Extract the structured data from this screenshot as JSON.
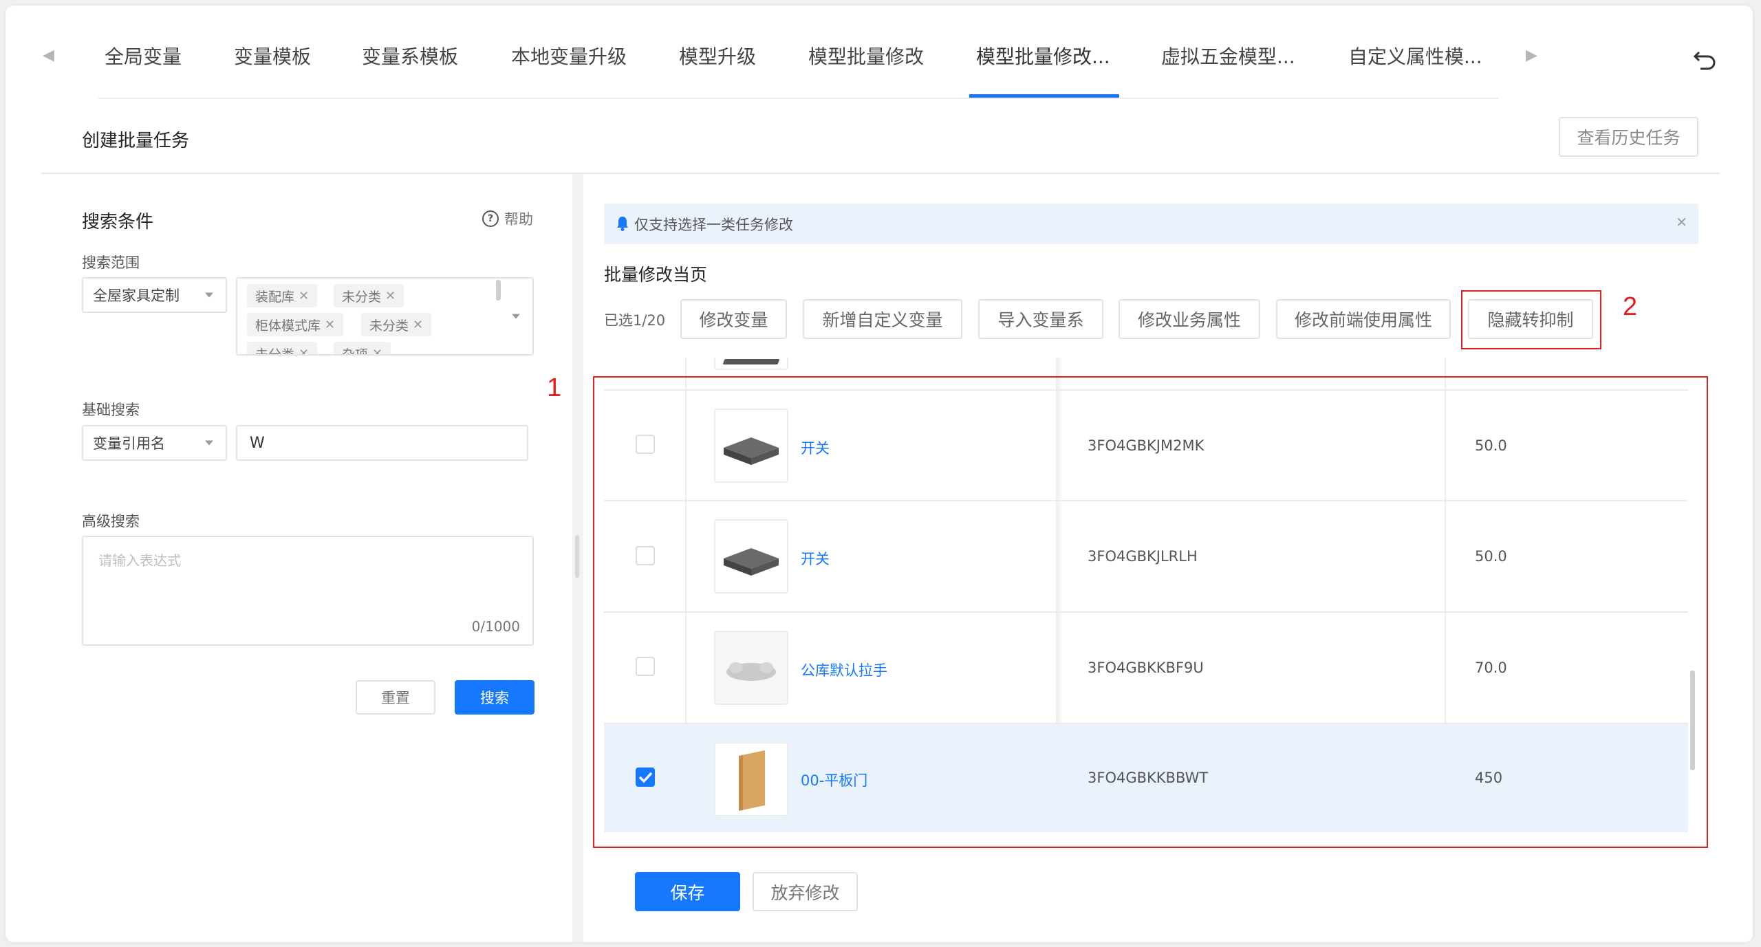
{
  "tabs": [
    {
      "label": "全局变量",
      "active": false
    },
    {
      "label": "变量模板",
      "active": false
    },
    {
      "label": "变量系模板",
      "active": false
    },
    {
      "label": "本地变量升级",
      "active": false
    },
    {
      "label": "模型升级",
      "active": false
    },
    {
      "label": "模型批量修改",
      "active": false
    },
    {
      "label": "模型批量修改...",
      "active": true
    },
    {
      "label": "虚拟五金模型...",
      "active": false
    },
    {
      "label": "自定义属性模...",
      "active": false
    }
  ],
  "header": {
    "title": "创建批量任务",
    "history_button": "查看历史任务"
  },
  "search": {
    "title": "搜索条件",
    "help": "帮助",
    "scope_label": "搜索范围",
    "scope_select": "全屋家具定制",
    "scope_tags": [
      "装配库",
      "未分类",
      "柜体模式库",
      "未分类",
      "未分类",
      "杂项"
    ],
    "basic_label": "基础搜索",
    "basic_select": "变量引用名",
    "basic_value": "W",
    "advanced_label": "高级搜索",
    "advanced_placeholder": "请输入表达式",
    "advanced_count": "0/1000",
    "reset_button": "重置",
    "search_button": "搜索"
  },
  "main": {
    "notice": "仅支持选择一类任务修改",
    "section_title": "批量修改当页",
    "selected_count": "已选1/20",
    "actions": [
      "修改变量",
      "新增自定义变量",
      "导入变量系",
      "修改业务属性",
      "修改前端使用属性",
      "隐藏转抑制"
    ],
    "rows": [
      {
        "name": "开关",
        "code": "3FO4GBKJM2MK",
        "value": "50.0",
        "checked": false,
        "thumb": "switch"
      },
      {
        "name": "开关",
        "code": "3FO4GBKJLRLH",
        "value": "50.0",
        "checked": false,
        "thumb": "switch"
      },
      {
        "name": "公库默认拉手",
        "code": "3FO4GBKKBF9U",
        "value": "70.0",
        "checked": false,
        "thumb": "handle"
      },
      {
        "name": "00-平板门",
        "code": "3FO4GBKKBBWT",
        "value": "450",
        "checked": true,
        "thumb": "door"
      }
    ],
    "save_button": "保存",
    "discard_button": "放弃修改"
  },
  "annotations": [
    "1",
    "2"
  ],
  "colors": {
    "primary": "#1677ff",
    "annotation": "#e02020",
    "notice_bg": "#eaf3fc",
    "selected_row_bg": "#eaf3fc"
  }
}
